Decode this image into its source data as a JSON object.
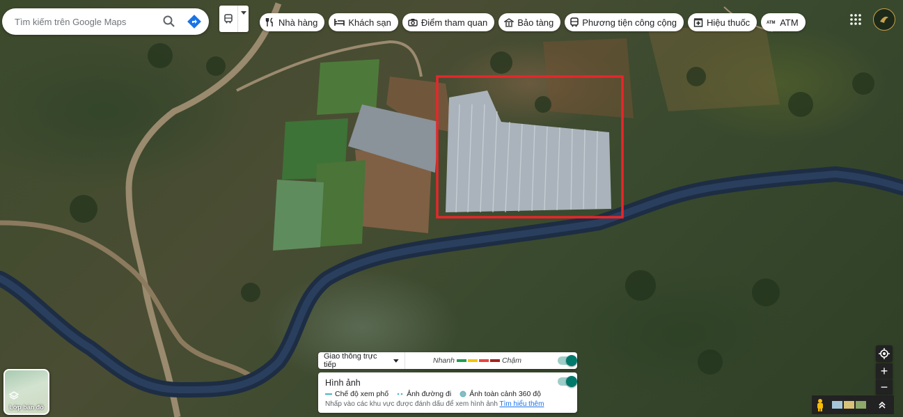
{
  "search": {
    "placeholder": "Tìm kiếm trên Google Maps",
    "icon": "search-icon",
    "directions_icon": "directions-icon"
  },
  "transit_selector": {
    "icon": "bus-icon"
  },
  "categories": [
    {
      "label": "Nhà hàng",
      "icon": "restaurant-icon"
    },
    {
      "label": "Khách sạn",
      "icon": "hotel-icon"
    },
    {
      "label": "Điểm tham quan",
      "icon": "camera-icon"
    },
    {
      "label": "Bảo tàng",
      "icon": "museum-icon"
    },
    {
      "label": "Phương tiện công cộng",
      "icon": "transit-icon"
    },
    {
      "label": "Hiệu thuốc",
      "icon": "pharmacy-icon"
    },
    {
      "label": "ATM",
      "icon": "atm-icon"
    }
  ],
  "header": {
    "apps_icon": "apps-grid-icon",
    "account_icon": "account-avatar-icon"
  },
  "layers": {
    "label": "Lớp bản đồ",
    "icon": "layers-icon"
  },
  "traffic": {
    "selector": "Giao thông trực tiếp",
    "fast_label": "Nhanh",
    "slow_label": "Chậm",
    "colors": [
      "#1e9e52",
      "#f5c400",
      "#e8453c",
      "#a4221c"
    ],
    "enabled": true
  },
  "imagery": {
    "title": "Hình ảnh",
    "enabled": true,
    "legend": [
      {
        "label": "Chế độ xem phố",
        "color": "#4fb9c4"
      },
      {
        "label": "Ảnh đường đi",
        "color": "#4fb9c4"
      },
      {
        "label": "Ảnh toàn cảnh 360 độ",
        "color": "#4fb9c4"
      }
    ],
    "hint": "Nhấp vào các khu vực được đánh dấu để xem hình ảnh",
    "learn_more": "Tìm hiểu thêm"
  },
  "map_controls": {
    "locate_icon": "my-location-icon",
    "zoom_in": "+",
    "zoom_out": "−",
    "pegman_icon": "pegman-icon",
    "expand_icon": "expand-up-icon"
  },
  "annotation": {
    "color": "#e8262a"
  }
}
